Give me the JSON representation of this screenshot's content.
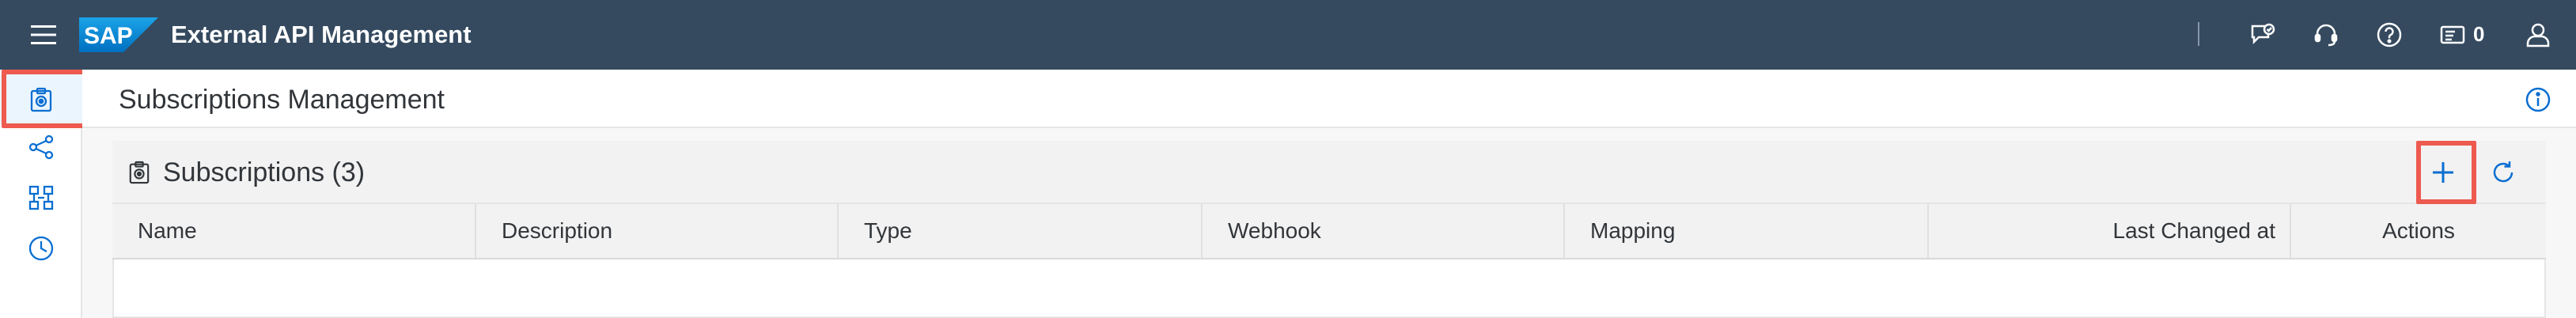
{
  "shell": {
    "app_title": "External API Management",
    "logo_text": "SAP",
    "notification_count": "0",
    "icons": [
      "menu-icon",
      "feedback-icon",
      "support-icon",
      "help-icon",
      "notifications-icon",
      "user-icon"
    ]
  },
  "sidenav": {
    "items": [
      {
        "icon": "subscriptions-icon",
        "selected": true
      },
      {
        "icon": "share-icon",
        "selected": false
      },
      {
        "icon": "mappings-icon",
        "selected": false
      },
      {
        "icon": "history-icon",
        "selected": false
      }
    ]
  },
  "page": {
    "title": "Subscriptions Management"
  },
  "table": {
    "title": "Subscriptions (3)",
    "columns": [
      "Name",
      "Description",
      "Type",
      "Webhook",
      "Mapping",
      "Last Changed at",
      "Actions"
    ]
  },
  "colors": {
    "shell_bg": "#354a5f",
    "accent": "#0a6ed1",
    "highlight": "#ee5a4f"
  }
}
